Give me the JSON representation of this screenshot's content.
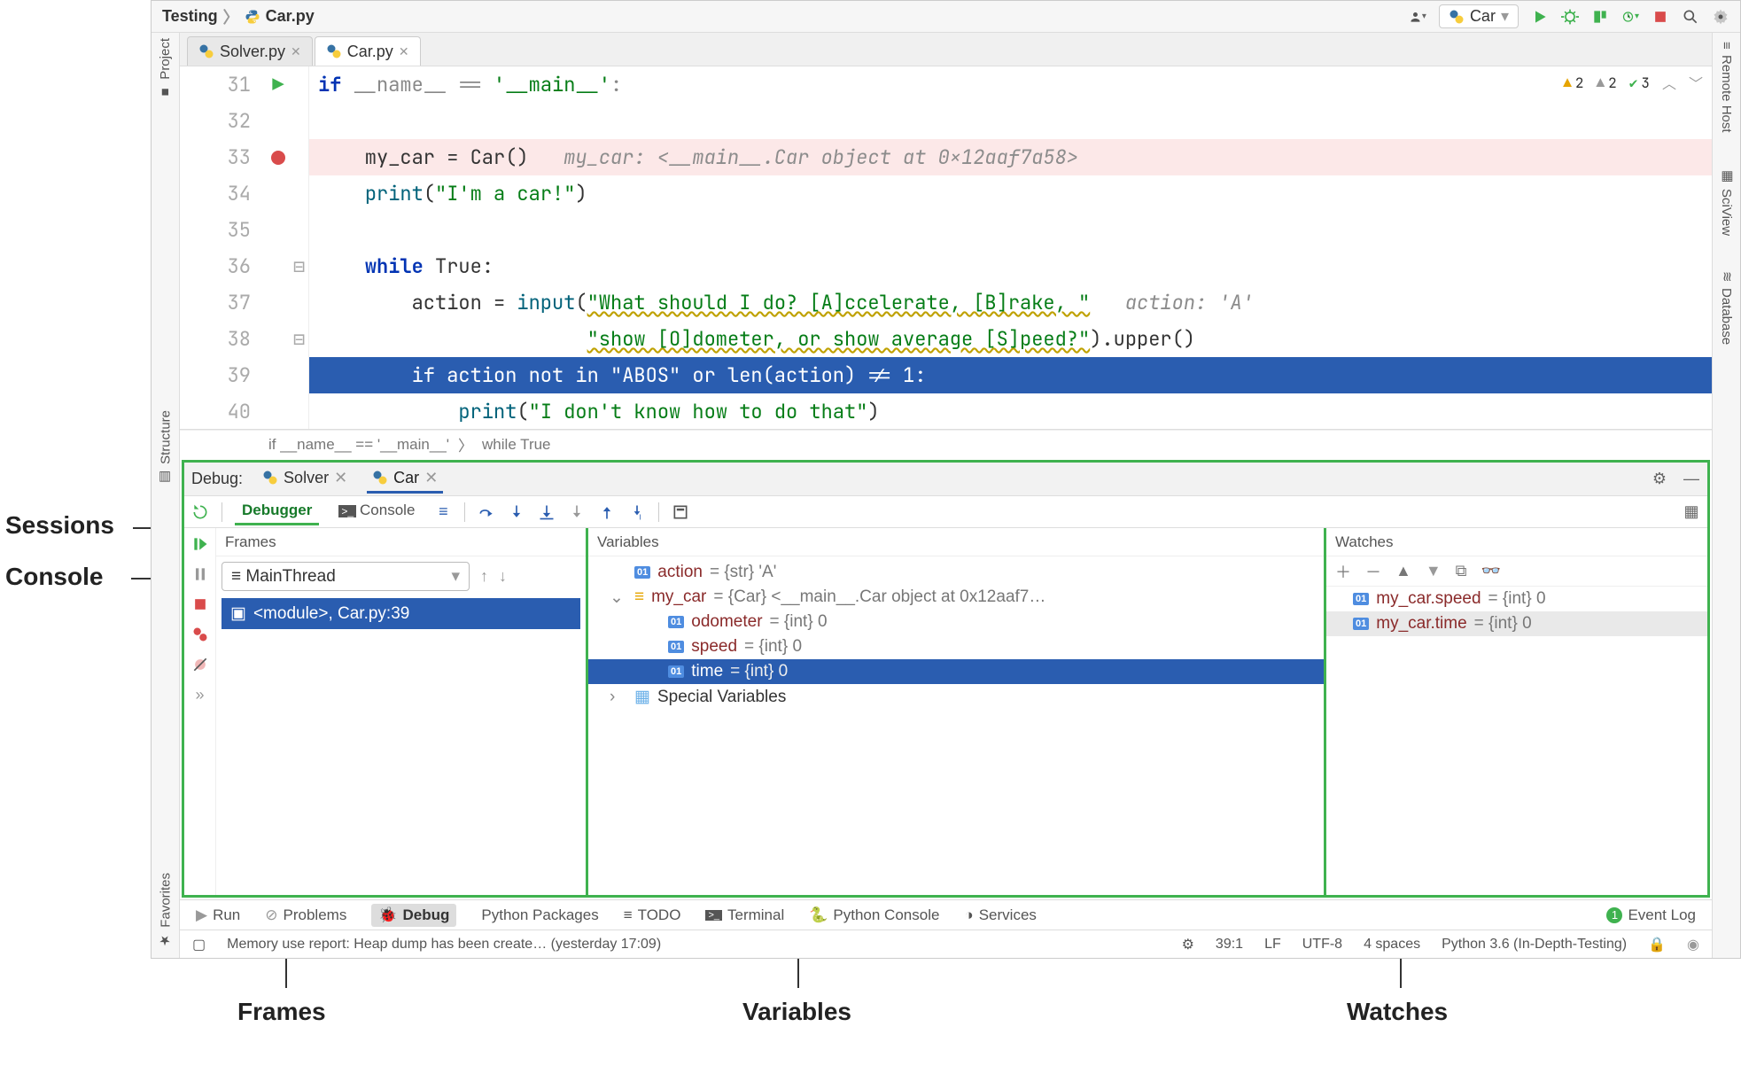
{
  "breadcrumb": {
    "project": "Testing",
    "file": "Car.py"
  },
  "run_config": {
    "name": "Car"
  },
  "editor_tabs": [
    {
      "label": "Solver.py",
      "active": false
    },
    {
      "label": "Car.py",
      "active": true
    }
  ],
  "inspections": {
    "warn1": "2",
    "warn2": "2",
    "ok": "3"
  },
  "editor_lines": {
    "l31_no": "31",
    "l32_no": "32",
    "l33_no": "33",
    "l34_no": "34",
    "l35_no": "35",
    "l36_no": "36",
    "l37_no": "37",
    "l38_no": "38",
    "l39_no": "39",
    "l40_no": "40",
    "l31": "if __name__ == '__main__':",
    "l33_code": "    my_car = Car()",
    "l33_hint": "   my_car: <__main__.Car object at 0x12aaf7a58>",
    "l34_a": "    ",
    "l34_fn": "print",
    "l34_b": "(",
    "l34_str": "\"I'm a car!\"",
    "l34_c": ")",
    "l36_a": "    ",
    "l36_kw": "while",
    "l36_b": " True:",
    "l37_a": "        action = ",
    "l37_fn": "input",
    "l37_b": "(",
    "l37_str": "\"What should I do? [A]ccelerate, [B]rake, \"",
    "l37_hint": "   action: 'A'",
    "l38_a": "                       ",
    "l38_str": "\"show [O]dometer, or show average [S]peed?\"",
    "l38_b": ").upper()",
    "l39": "        if action not in \"ABOS\" or len(action) != 1:",
    "l40_a": "            ",
    "l40_fn": "print",
    "l40_b": "(",
    "l40_str": "\"I don't know how to do that\"",
    "l40_c": ")"
  },
  "code_crumbs": {
    "a": "if __name__ == '__main__'",
    "b": "while True"
  },
  "debug": {
    "title": "Debug:",
    "sessions": [
      {
        "label": "Solver",
        "active": false
      },
      {
        "label": "Car",
        "active": true
      }
    ],
    "tabs": {
      "debugger": "Debugger",
      "console": "Console"
    },
    "frames": {
      "title": "Frames",
      "thread": "MainThread",
      "stack0": "<module>, Car.py:39"
    },
    "variables": {
      "title": "Variables",
      "rows": {
        "action_name": "action",
        "action_rest": " = {str} 'A'",
        "mycar_name": "my_car",
        "mycar_rest": " = {Car} <__main__.Car object at 0x12aaf7…",
        "odo_name": "odometer",
        "odo_rest": " = {int} 0",
        "speed_name": "speed",
        "speed_rest": " = {int} 0",
        "time_name": "time",
        "time_rest": " = {int} 0",
        "special": "Special Variables"
      }
    },
    "watches": {
      "title": "Watches",
      "rows": {
        "w1_name": "my_car.speed",
        "w1_rest": " = {int} 0",
        "w2_name": "my_car.time",
        "w2_rest": " = {int} 0"
      }
    }
  },
  "tool_tabs": {
    "run": "Run",
    "problems": "Problems",
    "debug": "Debug",
    "pypkg": "Python Packages",
    "todo": "TODO",
    "terminal": "Terminal",
    "pyconsole": "Python Console",
    "services": "Services",
    "eventlog": "Event Log",
    "eventcount": "1"
  },
  "status": {
    "msg": "Memory use report: Heap dump has been create… (yesterday 17:09)",
    "pos": "39:1",
    "lf": "LF",
    "enc": "UTF-8",
    "indent": "4 spaces",
    "sdk": "Python 3.6 (In-Depth-Testing)"
  },
  "side_tabs": {
    "project": "Project",
    "structure": "Structure",
    "favorites": "Favorites",
    "remote": "Remote Host",
    "sciview": "SciView",
    "database": "Database"
  },
  "annotations": {
    "sessions": "Sessions",
    "console": "Console",
    "frames": "Frames",
    "variables": "Variables",
    "watches": "Watches"
  }
}
